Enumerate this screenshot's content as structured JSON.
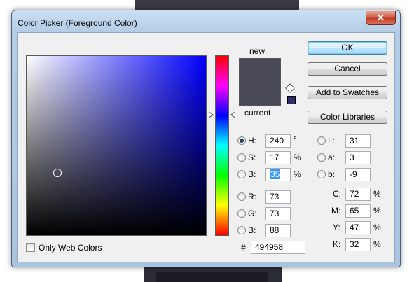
{
  "window": {
    "title": "Color Picker (Foreground Color)",
    "close_glyph": "✕"
  },
  "preview": {
    "new_label": "new",
    "current_label": "current",
    "new_color": "#494958",
    "current_color": "#494958"
  },
  "buttons": {
    "ok": "OK",
    "cancel": "Cancel",
    "add_to_swatches": "Add to Swatches",
    "color_libraries": "Color Libraries"
  },
  "hsb": [
    {
      "label": "H:",
      "value": "240",
      "unit": "°",
      "checked": true
    },
    {
      "label": "S:",
      "value": "17",
      "unit": "%",
      "checked": false
    },
    {
      "label": "B:",
      "value": "35",
      "unit": "%",
      "checked": false
    }
  ],
  "rgb": [
    {
      "label": "R:",
      "value": "73"
    },
    {
      "label": "G:",
      "value": "73"
    },
    {
      "label": "B:",
      "value": "88"
    }
  ],
  "lab": [
    {
      "label": "L:",
      "value": "31"
    },
    {
      "label": "a:",
      "value": "3"
    },
    {
      "label": "b:",
      "value": "-9"
    }
  ],
  "cmyk": [
    {
      "label": "C:",
      "value": "72",
      "unit": "%"
    },
    {
      "label": "M:",
      "value": "65",
      "unit": "%"
    },
    {
      "label": "Y:",
      "value": "47",
      "unit": "%"
    },
    {
      "label": "K:",
      "value": "32",
      "unit": "%"
    }
  ],
  "hex": {
    "label": "#",
    "value": "494958"
  },
  "only_web_colors": "Only Web Colors",
  "websafe_color": "#2e2e6e"
}
